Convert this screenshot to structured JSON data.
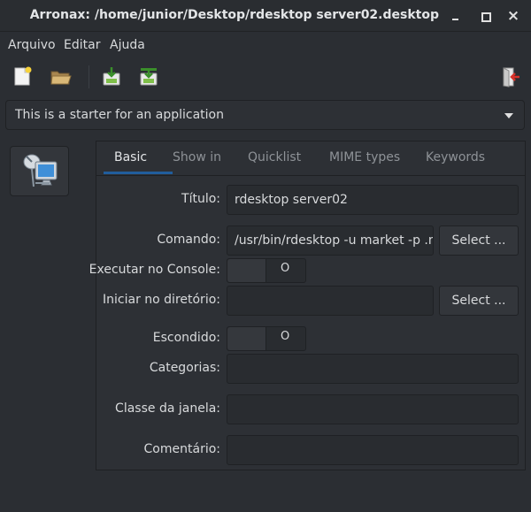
{
  "window": {
    "title": "Arronax: /home/junior/Desktop/rdesktop server02.desktop",
    "close_glyph": "×"
  },
  "menubar": {
    "items": [
      "Arquivo",
      "Editar",
      "Ajuda"
    ]
  },
  "toolbar": {
    "icons": [
      "new-file-icon",
      "open-folder-icon",
      "save-icon",
      "save-as-icon",
      "quit-icon"
    ]
  },
  "starter": {
    "selected": "This is a starter for an application"
  },
  "tabs": {
    "items": [
      "Basic",
      "Show in",
      "Quicklist",
      "MIME types",
      "Keywords"
    ],
    "active": "Basic"
  },
  "form": {
    "titulo_label": "Título:",
    "titulo_value": "rdesktop server02",
    "comando_label": "Comando:",
    "comando_value": "/usr/bin/rdesktop -u market -p .ma",
    "select_label": "Select ...",
    "console_label": "Executar no Console:",
    "switch_off": "O",
    "diretorio_label": "Iniciar no diretório:",
    "diretorio_value": "",
    "escondido_label": "Escondido:",
    "categorias_label": "Categorias:",
    "categorias_value": "",
    "classe_label": "Classe da janela:",
    "classe_value": "",
    "comentario_label": "Comentário:",
    "comentario_value": ""
  },
  "colors": {
    "background": "#2b2e33",
    "accent": "#215d9c"
  }
}
